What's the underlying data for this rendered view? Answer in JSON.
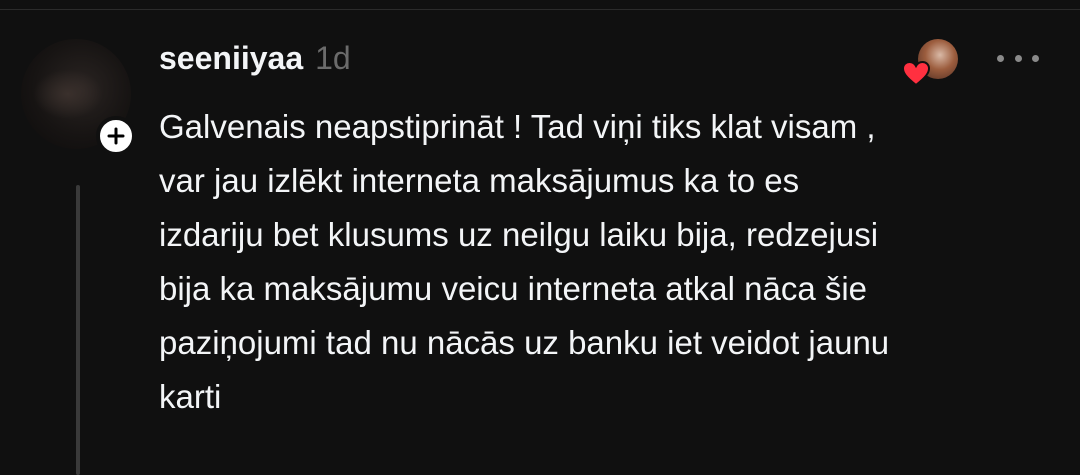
{
  "comment": {
    "username": "seeniiyaa",
    "timestamp": "1d",
    "text_lines": [
      "Galvenais neapstiprināt ! Tad viņi tiks klat visam ,",
      "var jau izlēkt interneta maksājumus ka to es",
      "izdariju bet klusums uz neilgu laiku bija, redzejusi",
      "bija ka maksājumu veicu interneta atkal nāca šie",
      "paziņojumi tad nu nācās uz banku iet veidot jaunu",
      "karti"
    ]
  },
  "icons": {
    "follow": "plus-icon",
    "liked": "heart-icon",
    "menu": "more-horizontal-icon"
  },
  "colors": {
    "background": "#101010",
    "text": "#f3f5f7",
    "muted": "#6b6b6b",
    "heart": "#ff3040",
    "thread_line": "#3a3a3a"
  }
}
